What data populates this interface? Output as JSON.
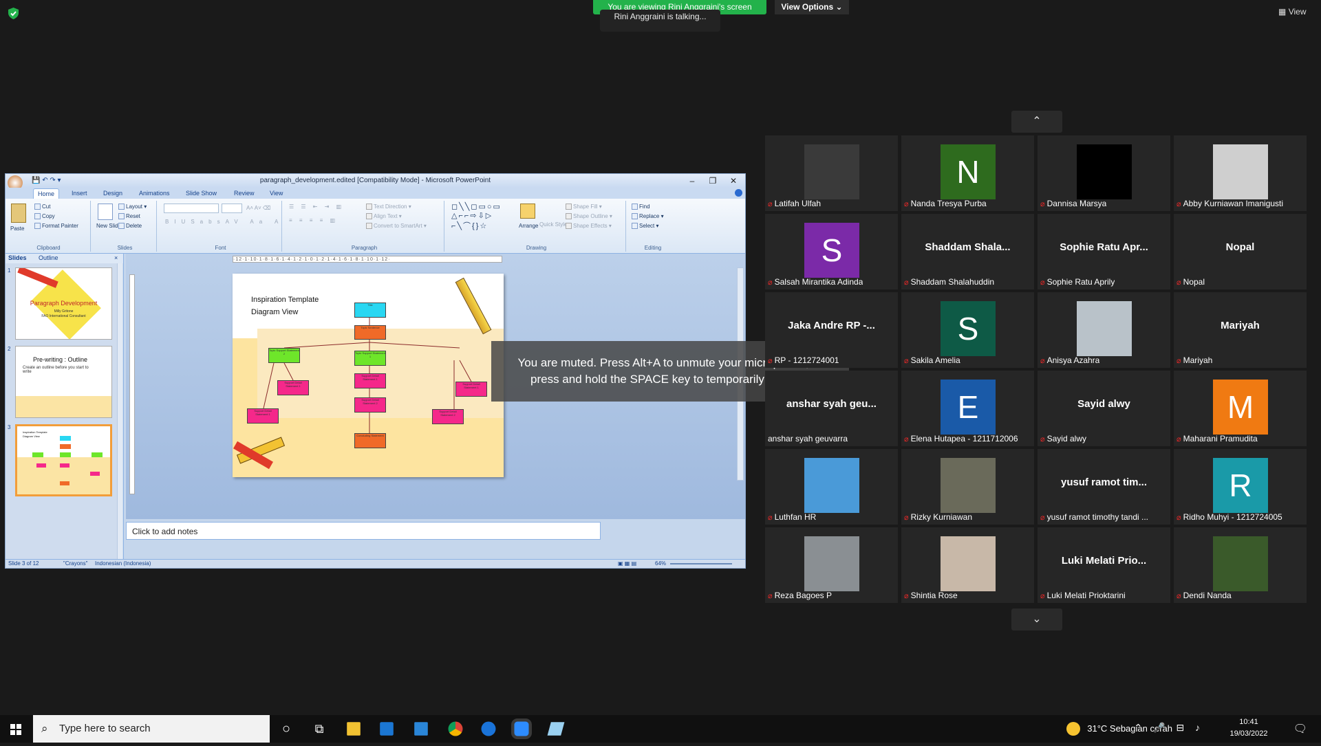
{
  "zoom": {
    "banner": "You are viewing Rini Anggraini's screen",
    "view_options": "View Options",
    "talking": "Rini Anggraini is talking...",
    "view_button": "View",
    "muted_message_line1": "You are muted. Press Alt+A to unmute your microphone, or",
    "muted_message_line2": "press and hold the SPACE key to temporarily unmute."
  },
  "ppt": {
    "title": "paragraph_development.edited [Compatibility Mode] - Microsoft PowerPoint",
    "tabs": [
      "Home",
      "Insert",
      "Design",
      "Animations",
      "Slide Show",
      "Review",
      "View"
    ],
    "clipboard": {
      "paste": "Paste",
      "cut": "Cut",
      "copy": "Copy",
      "format_painter": "Format Painter",
      "label": "Clipboard"
    },
    "slides_group": {
      "new_slide": "New Slide",
      "layout": "Layout",
      "reset": "Reset",
      "delete": "Delete",
      "label": "Slides"
    },
    "font_label": "Font",
    "paragraph": {
      "text_direction": "Text Direction",
      "align_text": "Align Text",
      "convert": "Convert to SmartArt",
      "label": "Paragraph"
    },
    "drawing": {
      "arrange": "Arrange",
      "quick_styles": "Quick Styles",
      "shape_fill": "Shape Fill",
      "shape_outline": "Shape Outline",
      "shape_effects": "Shape Effects",
      "label": "Drawing"
    },
    "editing": {
      "find": "Find",
      "replace": "Replace",
      "select": "Select",
      "label": "Editing"
    },
    "pane_tabs": {
      "slides": "Slides",
      "outline": "Outline"
    },
    "thumbs": [
      {
        "num": "1",
        "title": "Paragraph Development",
        "sub1": "Milly Gritone",
        "sub2": "FAO International Consultant"
      },
      {
        "num": "2",
        "title": "Pre-writing : Outline",
        "sub1": "Create an outline before you start to write"
      },
      {
        "num": "3",
        "title": "Inspiration Template",
        "sub1": "Diagram View"
      }
    ],
    "ruler": "·12·1·10·1·8·1·6·1·4·1·2·1·0·1·2·1·4·1·6·1·8·1·10·1·12·",
    "slide": {
      "title1": "Inspiration Template",
      "title2": "Diagram View",
      "boxes": {
        "title": "Title",
        "topic": "Topic Sentence",
        "ts2": "Topic Support Statement 2",
        "ts1": "Topic Support Statement 1",
        "sd_a": "Support Detail Statement 1",
        "sd_b": "Support Detail Statement 1",
        "sd_c": "Support Detail Statement 2",
        "sd_d": "Support Detail Statement 1",
        "sd_e": "Support Detail Statement 1",
        "sd_f": "Support Detail Statement 2",
        "concluding": "Concluding Statement"
      }
    },
    "notes": "Click to add notes",
    "status": {
      "slide": "Slide 3 of 12",
      "theme": "\"Crayons\"",
      "language": "Indonesian (Indonesia)",
      "zoom": "64%"
    }
  },
  "participants": [
    {
      "name": "Latifah Ulfah",
      "type": "photo",
      "color": "#3a3a3a"
    },
    {
      "name": "Nanda Tresya Purba",
      "type": "letter",
      "letter": "N",
      "color": "#2e6b1e"
    },
    {
      "name": "Dannisa Marsya",
      "type": "black",
      "color": "#000000"
    },
    {
      "name": "Abby Kurniawan Imanigusti",
      "type": "photo",
      "color": "#cfcfcf"
    },
    {
      "name": "Salsah Mirantika Adinda",
      "type": "letter",
      "letter": "S",
      "color": "#7b2aa8"
    },
    {
      "name": "Shaddam Shalahuddin",
      "type": "text",
      "display": "Shaddam  Shala..."
    },
    {
      "name": "Sophie Ratu Aprily",
      "type": "text",
      "display": "Sophie Ratu Apr..."
    },
    {
      "name": "Nopal",
      "type": "text",
      "display": "Nopal"
    },
    {
      "name": "RP - 1212724001",
      "type": "text",
      "display": "Jaka Andre RP -..."
    },
    {
      "name": "Sakila Amelia",
      "type": "letter",
      "letter": "S",
      "color": "#0e5a46"
    },
    {
      "name": "Anisya Azahra",
      "type": "photo",
      "color": "#b9c2c9"
    },
    {
      "name": "Mariyah",
      "type": "text",
      "display": "Mariyah"
    },
    {
      "name": "anshar syah geuvarra",
      "type": "text",
      "display": "anshar syah geu...",
      "nomic": true
    },
    {
      "name": "Elena Hutapea - 1211712006",
      "type": "letter",
      "letter": "E",
      "color": "#1a5aa8"
    },
    {
      "name": "Sayid alwy",
      "type": "text",
      "display": "Sayid alwy"
    },
    {
      "name": "Maharani Pramudita",
      "type": "letter",
      "letter": "M",
      "color": "#f07a12"
    },
    {
      "name": "Luthfan HR",
      "type": "photo",
      "color": "#4a9ad8"
    },
    {
      "name": "Rizky Kurniawan",
      "type": "photo",
      "color": "#6a6a5a"
    },
    {
      "name": "yusuf ramot timothy tandi ...",
      "type": "text",
      "display": "yusuf ramot tim..."
    },
    {
      "name": "Ridho Muhyi - 1212724005",
      "type": "letter",
      "letter": "R",
      "color": "#1a9aa8"
    },
    {
      "name": "Reza Bagoes P",
      "type": "photo",
      "color": "#8a8f93"
    },
    {
      "name": "Shintia Rose",
      "type": "photo",
      "color": "#c8b8a8"
    },
    {
      "name": "Luki Melati Prioktarini",
      "type": "text",
      "display": "Luki Melati Prio..."
    },
    {
      "name": "Dendi Nanda",
      "type": "photo",
      "color": "#3a5a2a"
    }
  ],
  "taskbar": {
    "search_placeholder": "Type here to search",
    "weather": "31°C  Sebagian cerah",
    "time": "10:41",
    "date": "19/03/2022"
  }
}
